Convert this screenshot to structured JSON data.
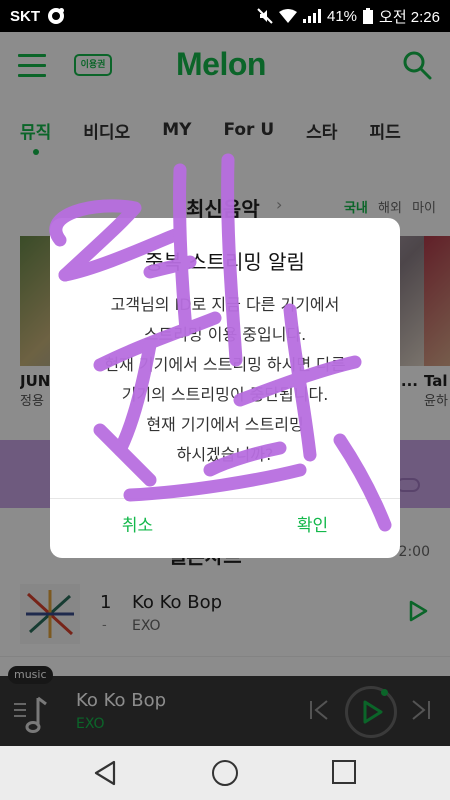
{
  "status_bar": {
    "carrier": "SKT",
    "battery": "41%",
    "time": "오전 2:26"
  },
  "header": {
    "ticket_label": "이용권",
    "logo": "Melon"
  },
  "tabs": [
    "뮤직",
    "비디오",
    "MY",
    "For U",
    "스타",
    "피드"
  ],
  "latest": {
    "title": "최신음악",
    "filters": [
      "국내",
      "해외",
      "마이"
    ],
    "albums": [
      {
        "title": "JUN",
        "artist": "정용"
      },
      {
        "title": "...",
        "artist": ""
      },
      {
        "title": "Tal",
        "artist": "윤하"
      }
    ]
  },
  "chart": {
    "title": "멜론차트",
    "time": "2:00",
    "songs": [
      {
        "rank": "1",
        "change": "-",
        "title": "Ko Ko Bop",
        "artist": "EXO"
      }
    ]
  },
  "player": {
    "badge": "music",
    "title": "Ko Ko Bop",
    "artist": "EXO"
  },
  "dialog": {
    "title": "중복 스트리밍 알림",
    "body_lines": [
      "고객님의 ID로 지금 다른 기기에서",
      "스트리밍 이용 중입니다.",
      "현재 기기에서 스트리밍 하시면 다른",
      "기기의 스트리밍이 중단됩니다.",
      "현재 기기에서 스트리밍",
      "하시겠습니까?"
    ],
    "cancel": "취소",
    "ok": "확인"
  },
  "colors": {
    "accent": "#14b84b",
    "scribble": "#b86ee0",
    "banner": "#c9a5e6"
  },
  "handwriting": "엑소"
}
